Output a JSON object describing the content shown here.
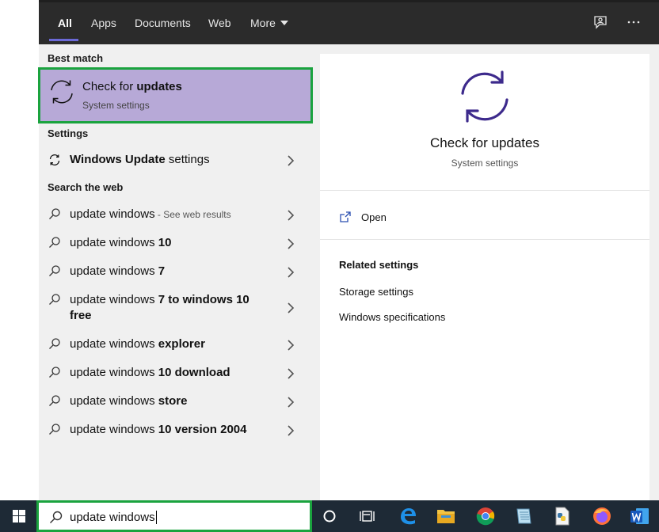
{
  "tabs": [
    {
      "label": "All"
    },
    {
      "label": "Apps"
    },
    {
      "label": "Documents"
    },
    {
      "label": "Web"
    },
    {
      "label": "More"
    }
  ],
  "icons": {
    "feedback": "feedback-icon",
    "options": "ellipsis-icon"
  },
  "best_match": {
    "section_label": "Best match",
    "title_prefix": "Check for ",
    "title_bold": "updates",
    "subtitle": "System settings"
  },
  "settings": {
    "section_label": "Settings",
    "item_bold": "Windows Update",
    "item_rest": " settings"
  },
  "web": {
    "section_label": "Search the web",
    "items": [
      {
        "plain": "update windows",
        "bold": "",
        "hint": " - See web results"
      },
      {
        "plain": "update windows ",
        "bold": "10",
        "hint": ""
      },
      {
        "plain": "update windows ",
        "bold": "7",
        "hint": ""
      },
      {
        "plain": "update windows ",
        "bold": "7 to windows 10 free",
        "hint": ""
      },
      {
        "plain": "update windows ",
        "bold": "explorer",
        "hint": ""
      },
      {
        "plain": "update windows ",
        "bold": "10 download",
        "hint": ""
      },
      {
        "plain": "update windows ",
        "bold": "store",
        "hint": ""
      },
      {
        "plain": "update windows ",
        "bold": "10 version 2004",
        "hint": ""
      }
    ]
  },
  "preview": {
    "title": "Check for updates",
    "subtitle": "System settings",
    "open_label": "Open",
    "related_heading": "Related settings",
    "related_links": [
      "Storage settings",
      "Windows specifications"
    ]
  },
  "search": {
    "value": "update windows"
  },
  "colors": {
    "accent": "#6b69d6",
    "highlight_border": "#1aa33e",
    "best_match_bg": "#b7a9d7",
    "update_icon": "#3d2a8c"
  },
  "taskbar_apps": [
    "cortana-icon",
    "task-view-icon",
    "edge-icon",
    "file-explorer-icon",
    "chrome-icon",
    "notepad-icon",
    "python-file-icon",
    "firefox-icon",
    "word-icon"
  ]
}
